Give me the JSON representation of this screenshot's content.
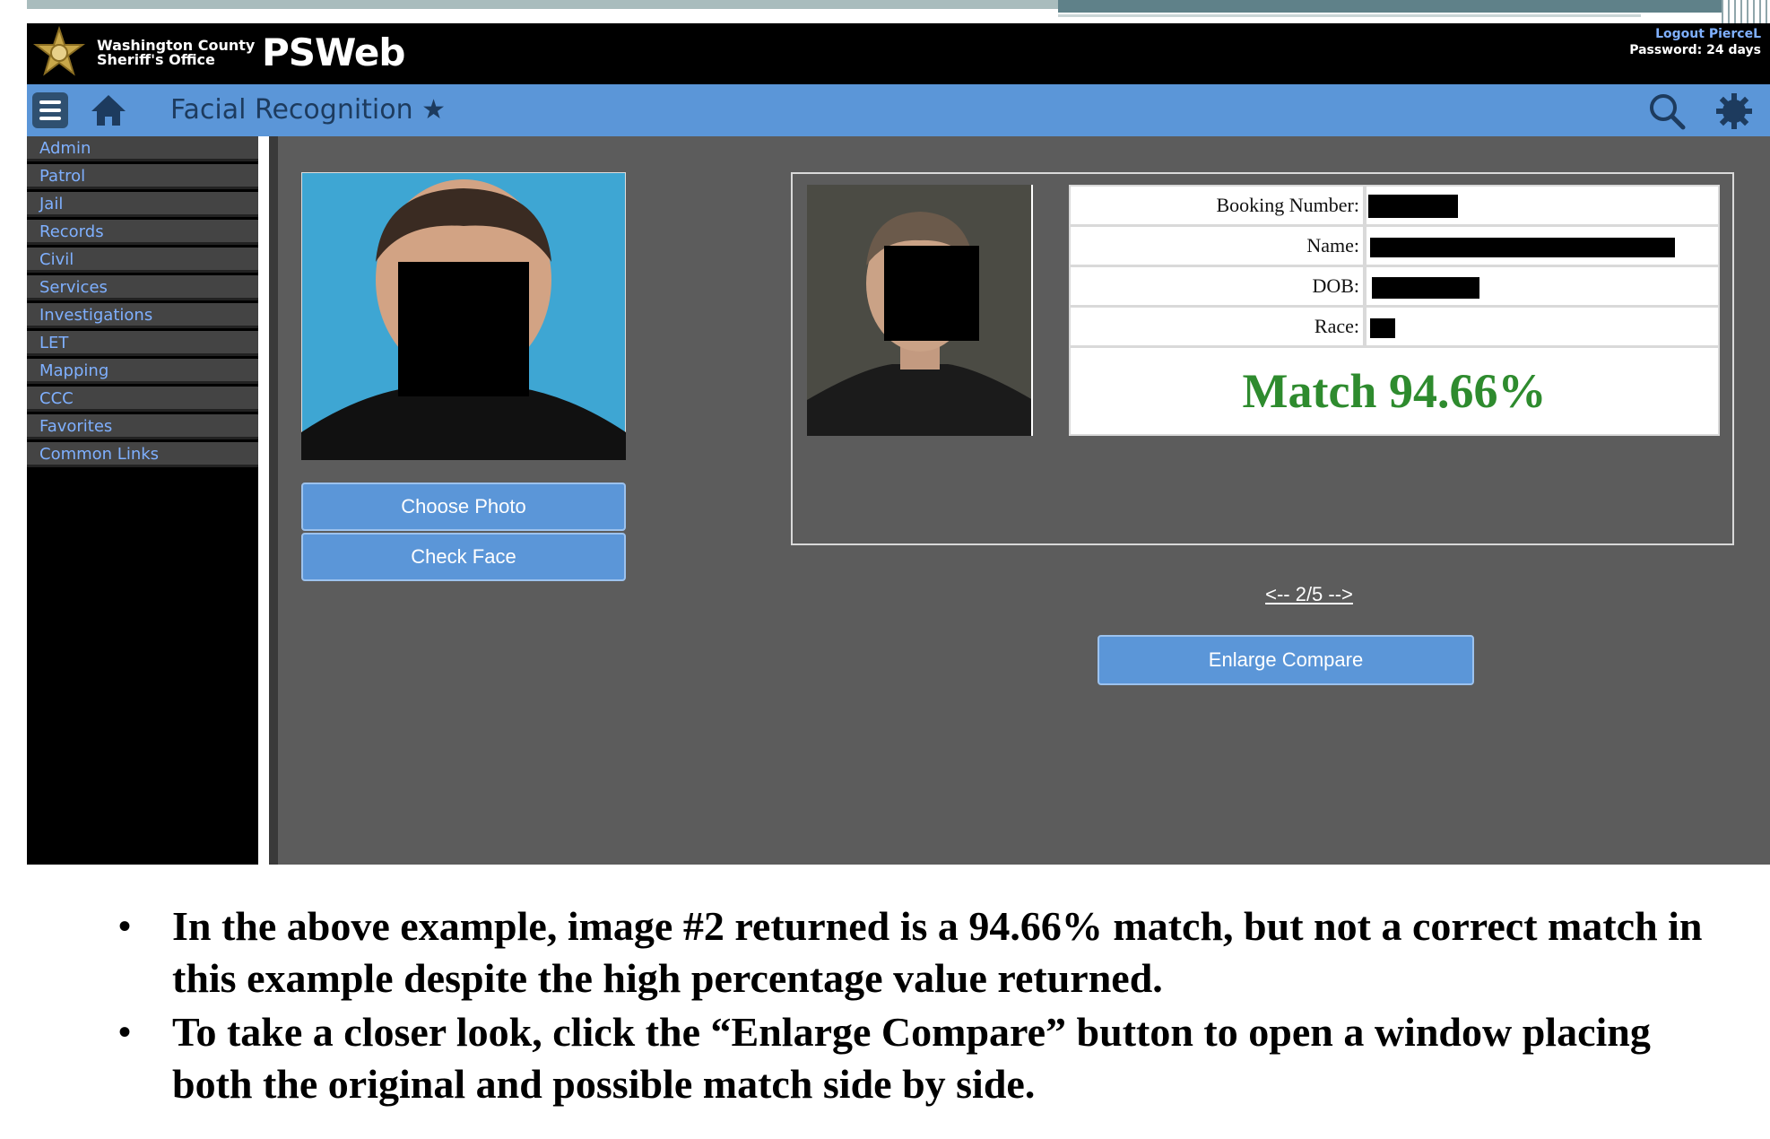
{
  "header": {
    "org_line1": "Washington County",
    "org_line2": "Sheriff's Office",
    "app_title": "PSWeb",
    "logout": "Logout PierceL",
    "password_status": "Password: 24 days"
  },
  "navbar": {
    "page_title": "Facial Recognition ★",
    "icons": [
      "menu-icon",
      "home-icon",
      "search-icon",
      "gear-icon"
    ]
  },
  "sidebar": {
    "items": [
      {
        "label": "Admin"
      },
      {
        "label": "Patrol"
      },
      {
        "label": "Jail"
      },
      {
        "label": "Records"
      },
      {
        "label": "Civil"
      },
      {
        "label": "Services"
      },
      {
        "label": "Investigations"
      },
      {
        "label": "LET"
      },
      {
        "label": "Mapping"
      },
      {
        "label": "CCC"
      },
      {
        "label": "Favorites"
      },
      {
        "label": "Common Links"
      }
    ]
  },
  "upload": {
    "choose_photo": "Choose Photo",
    "check_face": "Check Face"
  },
  "result": {
    "fields": [
      {
        "label": "Booking Number:"
      },
      {
        "label": "Name:"
      },
      {
        "label": "DOB:"
      },
      {
        "label": "Race:"
      }
    ],
    "match": "Match 94.66%",
    "pager": "<-- 2/5 -->",
    "enlarge": "Enlarge Compare"
  },
  "notes": [
    "In the above example, image #2 returned is a 94.66% match, but not a correct match in this example despite the high percentage value returned.",
    "To take a closer look, click the “Enlarge Compare” button to open a window placing both the original and possible match side by side."
  ],
  "colors": {
    "navbar": "#5b96d8",
    "sidebar_link": "#7fb0ff",
    "match_green": "#2e8b2e",
    "main_bg": "#5c5c5c"
  }
}
